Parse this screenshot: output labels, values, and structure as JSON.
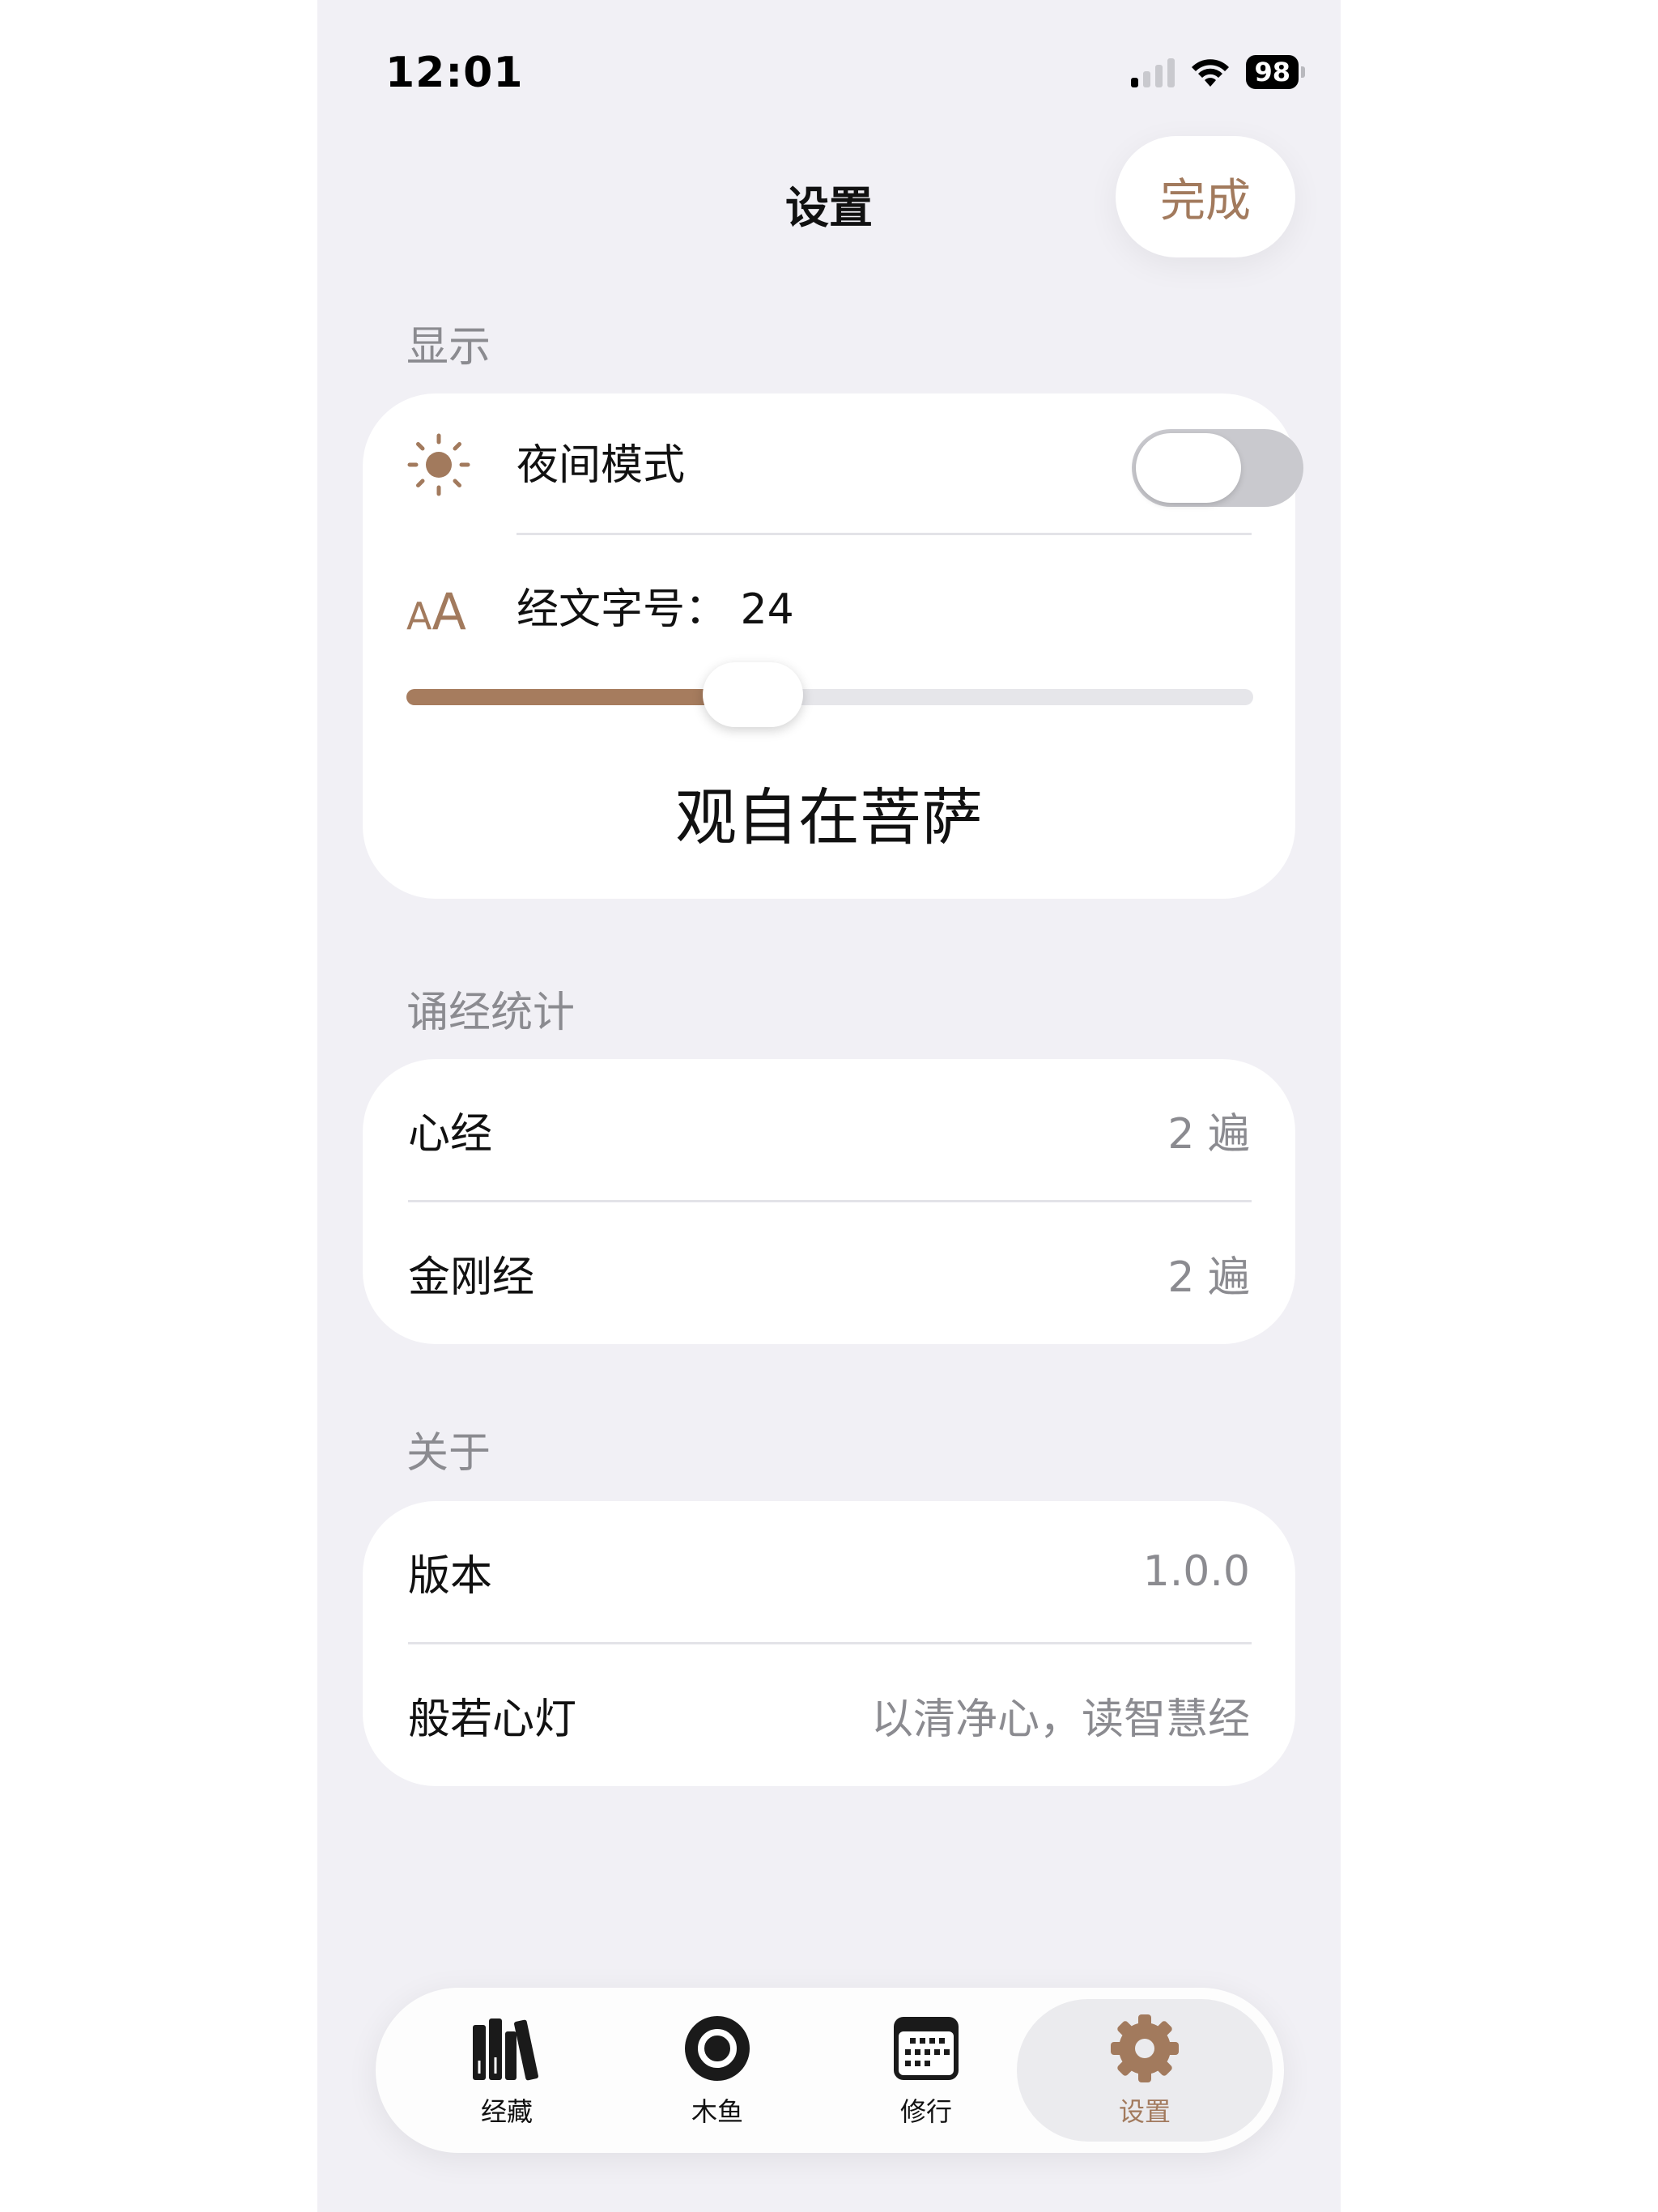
{
  "status_bar": {
    "time": "12:01",
    "battery_level": "98"
  },
  "nav": {
    "title": "设置",
    "done_label": "完成"
  },
  "display_section": {
    "header": "显示",
    "night_mode_label": "夜间模式",
    "night_mode_on": false,
    "font_size_label": "经文字号： 24",
    "font_size_value": 24,
    "slider_fraction": 0.4,
    "preview_text": "观自在菩萨",
    "accent_color": "#a27a5d"
  },
  "stats_section": {
    "header": "诵经统计",
    "rows": [
      {
        "label": "心经",
        "value": "2 遍"
      },
      {
        "label": "金刚经",
        "value": "2 遍"
      }
    ]
  },
  "about_section": {
    "header": "关于",
    "rows": [
      {
        "label": "版本",
        "value": "1.0.0"
      },
      {
        "label": "般若心灯",
        "value": "以清净心，读智慧经"
      }
    ]
  },
  "tabbar": {
    "tabs": [
      {
        "label": "经藏",
        "icon": "books-icon"
      },
      {
        "label": "木鱼",
        "icon": "muyu-icon"
      },
      {
        "label": "修行",
        "icon": "calendar-icon"
      },
      {
        "label": "设置",
        "icon": "gear-icon"
      }
    ],
    "selected": "设置"
  }
}
